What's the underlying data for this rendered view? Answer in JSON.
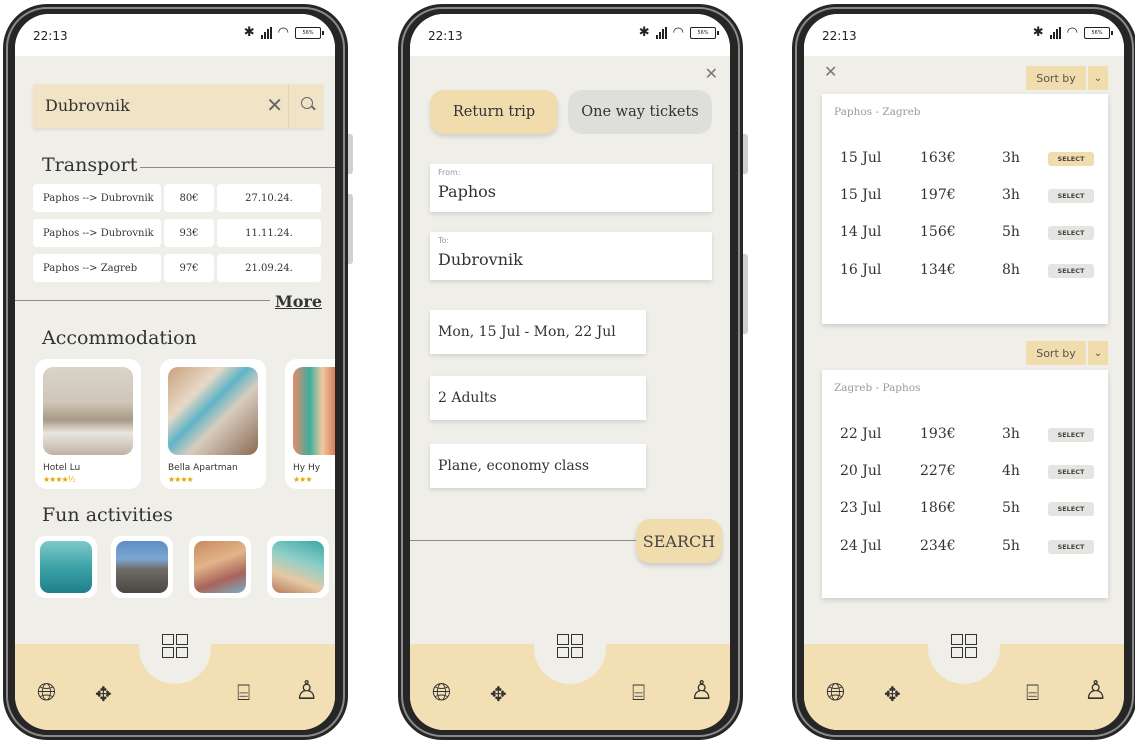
{
  "status_time": "22:13",
  "battery": "56%",
  "screen1": {
    "search_value": "Dubrovnik",
    "transport_title": "Transport",
    "transport_rows": [
      {
        "route": "Paphos --> Dubrovnik",
        "price": "80€",
        "date": "27.10.24."
      },
      {
        "route": "Paphos --> Dubrovnik",
        "price": "93€",
        "date": "11.11.24."
      },
      {
        "route": "Paphos --> Zagreb",
        "price": "97€",
        "date": "21.09.24."
      }
    ],
    "more_label": "More",
    "accommodation_title": "Accommodation",
    "hotels": [
      {
        "name": "Hotel Lu",
        "stars": "★★★★½",
        "rating": 4.5
      },
      {
        "name": "Bella Apartman",
        "stars": "★★★★",
        "rating": 4
      },
      {
        "name": "Hy Hy",
        "stars": "★★★",
        "rating": 3
      }
    ],
    "fun_title": "Fun activities"
  },
  "screen2": {
    "return_trip": "Return trip",
    "one_way": "One way tickets",
    "from_label": "From:",
    "from_value": "Paphos",
    "to_label": "To:",
    "to_value": "Dubrovnik",
    "dates": "Mon, 15 Jul - Mon, 22 Jul",
    "passengers": "2 Adults",
    "travel_class": "Plane, economy class",
    "search_label": "SEARCH"
  },
  "screen3": {
    "sort_label": "Sort by",
    "outbound_route": "Paphos - Zagreb",
    "outbound": [
      {
        "date": "15 Jul",
        "price": "163€",
        "duration": "3h",
        "action": "SELECT",
        "selected": true
      },
      {
        "date": "15 Jul",
        "price": "197€",
        "duration": "3h",
        "action": "SELECT",
        "selected": false
      },
      {
        "date": "14 Jul",
        "price": "156€",
        "duration": "5h",
        "action": "SELECT",
        "selected": false
      },
      {
        "date": "16 Jul",
        "price": "134€",
        "duration": "8h",
        "action": "SELECT",
        "selected": false
      }
    ],
    "return_route": "Zagreb - Paphos",
    "return": [
      {
        "date": "22 Jul",
        "price": "193€",
        "duration": "3h",
        "action": "SELECT",
        "selected": false
      },
      {
        "date": "20 Jul",
        "price": "227€",
        "duration": "4h",
        "action": "SELECT",
        "selected": false
      },
      {
        "date": "23 Jul",
        "price": "186€",
        "duration": "5h",
        "action": "SELECT",
        "selected": false
      },
      {
        "date": "24 Jul",
        "price": "234€",
        "duration": "5h",
        "action": "SELECT",
        "selected": false
      }
    ]
  },
  "icons": {
    "nav": [
      "globe-plane-icon",
      "move-arrows-icon",
      "grid-icon",
      "ticket-icon",
      "user-icon"
    ]
  },
  "colors": {
    "accent": "#f1dcae",
    "nav_bg": "#f3dfb4",
    "screen_bg": "#efeee8",
    "inactive_pill": "#dededb"
  }
}
